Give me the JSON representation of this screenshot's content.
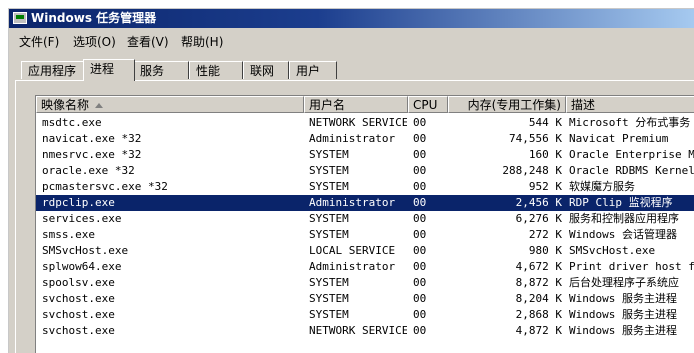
{
  "window": {
    "title": "Windows 任务管理器"
  },
  "menu": [
    {
      "label": "文件(F)"
    },
    {
      "label": "选项(O)"
    },
    {
      "label": "查看(V)"
    },
    {
      "label": "帮助(H)"
    }
  ],
  "tabs": [
    {
      "label": "应用程序",
      "active": false
    },
    {
      "label": "进程",
      "active": true
    },
    {
      "label": "服务",
      "active": false
    },
    {
      "label": "性能",
      "active": false
    },
    {
      "label": "联网",
      "active": false
    },
    {
      "label": "用户",
      "active": false
    }
  ],
  "columns": {
    "name": "映像名称",
    "user": "用户名",
    "cpu": "CPU",
    "memory": "内存(专用工作集)",
    "desc": "描述"
  },
  "processes": [
    {
      "name": "msdtc.exe",
      "user": "NETWORK SERVICE",
      "cpu": "00",
      "mem": "544 K",
      "desc": "Microsoft 分布式事务"
    },
    {
      "name": "navicat.exe *32",
      "user": "Administrator",
      "cpu": "00",
      "mem": "74,556 K",
      "desc": "Navicat Premium"
    },
    {
      "name": "nmesrvc.exe *32",
      "user": "SYSTEM",
      "cpu": "00",
      "mem": "160 K",
      "desc": "Oracle Enterprise M"
    },
    {
      "name": "oracle.exe *32",
      "user": "SYSTEM",
      "cpu": "00",
      "mem": "288,248 K",
      "desc": "Oracle RDBMS Kernel"
    },
    {
      "name": "pcmastersvc.exe *32",
      "user": "SYSTEM",
      "cpu": "00",
      "mem": "952 K",
      "desc": "软媒魔方服务"
    },
    {
      "name": "rdpclip.exe",
      "user": "Administrator",
      "cpu": "00",
      "mem": "2,456 K",
      "desc": "RDP Clip 监视程序",
      "selected": true
    },
    {
      "name": "services.exe",
      "user": "SYSTEM",
      "cpu": "00",
      "mem": "6,276 K",
      "desc": "服务和控制器应用程序"
    },
    {
      "name": "smss.exe",
      "user": "SYSTEM",
      "cpu": "00",
      "mem": "272 K",
      "desc": "Windows 会话管理器"
    },
    {
      "name": "SMSvcHost.exe",
      "user": "LOCAL SERVICE",
      "cpu": "00",
      "mem": "980 K",
      "desc": "SMSvcHost.exe"
    },
    {
      "name": "splwow64.exe",
      "user": "Administrator",
      "cpu": "00",
      "mem": "4,672 K",
      "desc": "Print driver host f"
    },
    {
      "name": "spoolsv.exe",
      "user": "SYSTEM",
      "cpu": "00",
      "mem": "8,872 K",
      "desc": "后台处理程序子系统应"
    },
    {
      "name": "svchost.exe",
      "user": "SYSTEM",
      "cpu": "00",
      "mem": "8,204 K",
      "desc": "Windows 服务主进程"
    },
    {
      "name": "svchost.exe",
      "user": "SYSTEM",
      "cpu": "00",
      "mem": "2,868 K",
      "desc": "Windows 服务主进程"
    },
    {
      "name": "svchost.exe",
      "user": "NETWORK SERVICE",
      "cpu": "00",
      "mem": "4,872 K",
      "desc": "Windows 服务主进程"
    }
  ],
  "colors": {
    "title_bar": "#0a246a",
    "selection": "#0a246a",
    "chrome": "#d4d0c8"
  }
}
